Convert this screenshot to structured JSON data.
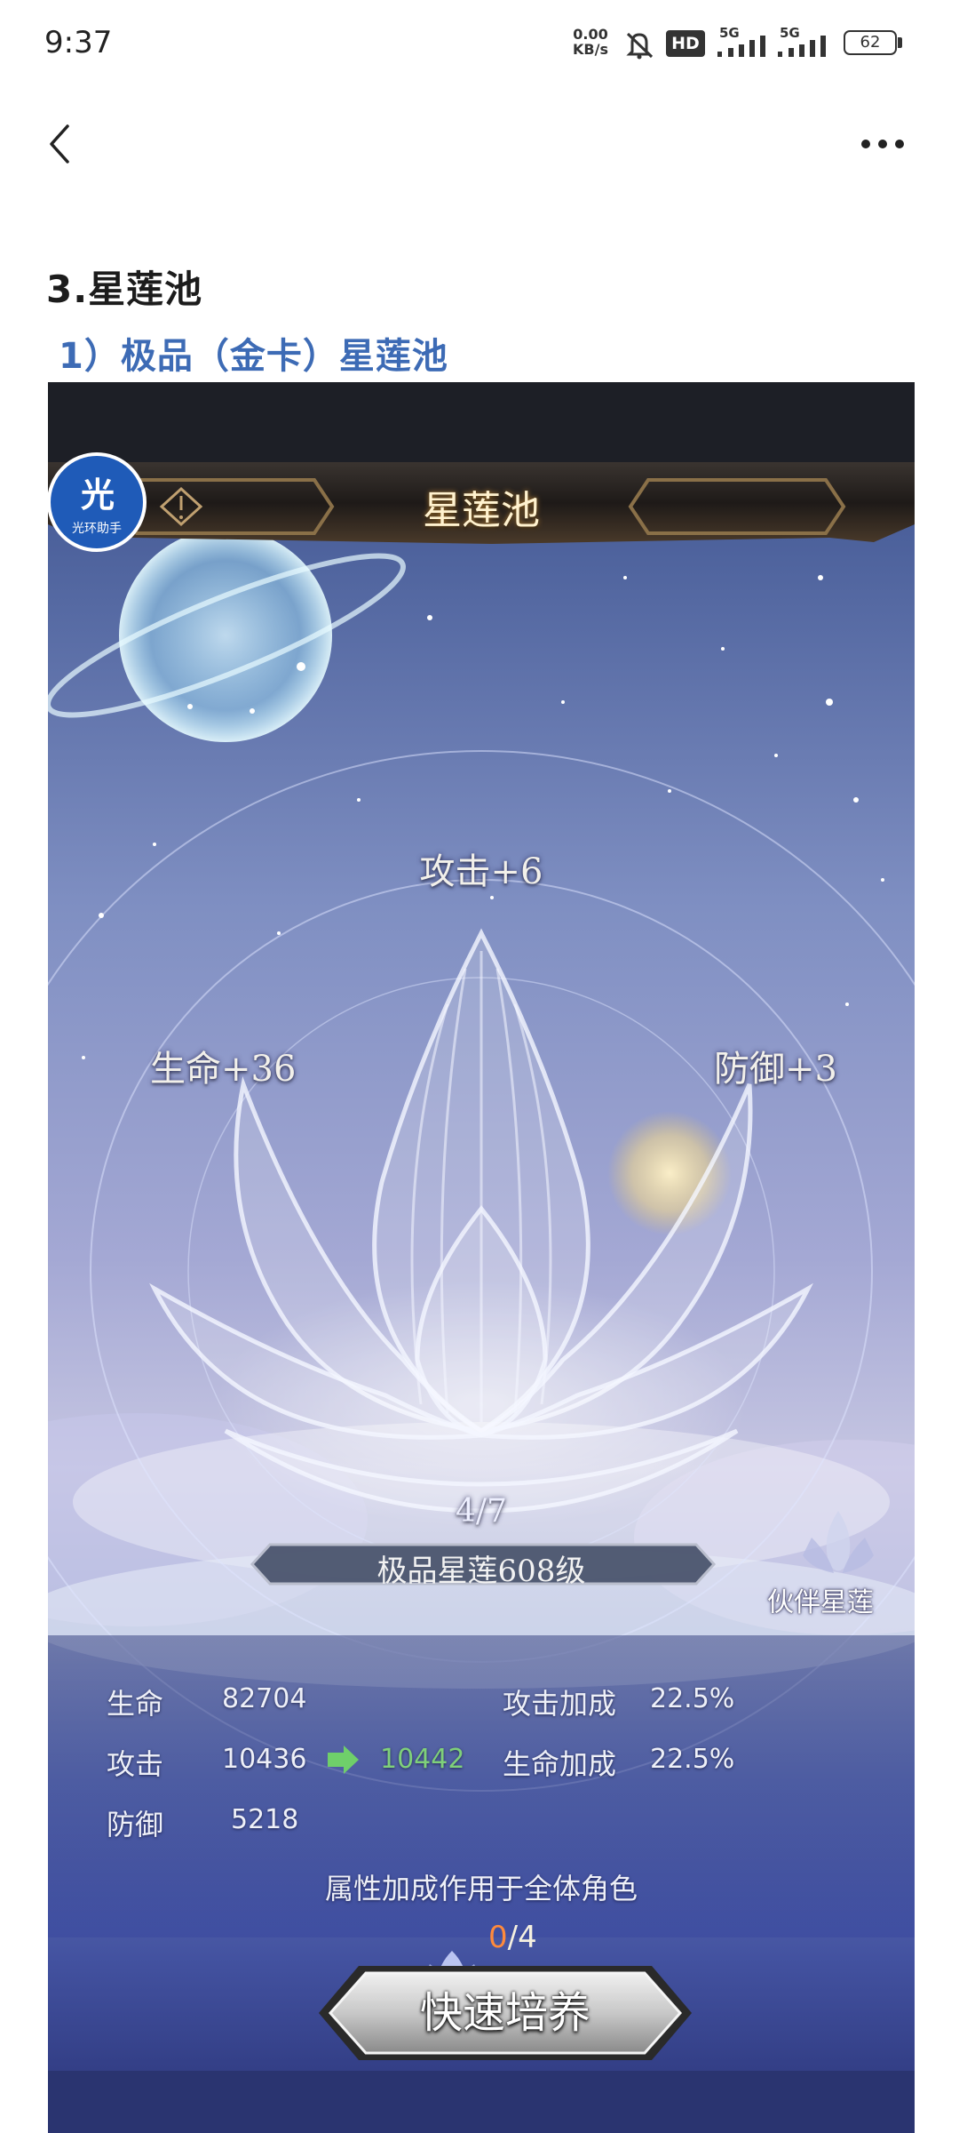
{
  "status_bar": {
    "time": "9:37",
    "net_speed_value": "0.00",
    "net_speed_unit": "KB/s",
    "hd_label": "HD",
    "network_1": "5G",
    "network_2": "5G",
    "battery": "62",
    "icons": [
      "mute-bell-icon",
      "hd-icon",
      "signal-icon",
      "signal-icon",
      "battery-icon"
    ]
  },
  "nav": {
    "back_icon": "chevron-left-icon",
    "more_icon": "more-horizontal-icon"
  },
  "article": {
    "heading_main": "3.星莲池",
    "heading_sub": "1）极品（金卡）星莲池"
  },
  "game": {
    "title": "星莲池",
    "badge_main": "光",
    "badge_sub": "光环助手",
    "bonus_top": "攻击+6",
    "bonus_left": "生命+36",
    "bonus_right": "防御+3",
    "progress": "4/7",
    "level_label": "极品星莲608级",
    "partner_label": "伙伴星莲",
    "stats": {
      "hp_label": "生命",
      "hp_value": "82704",
      "atk_label": "攻击",
      "atk_value": "10436",
      "atk_next": "10442",
      "def_label": "防御",
      "def_value": "5218",
      "atk_bonus_label": "攻击加成",
      "atk_bonus_value": "22.5%",
      "hp_bonus_label": "生命加成",
      "hp_bonus_value": "22.5%"
    },
    "note": "属性加成作用于全体角色",
    "counter_current": "0",
    "counter_sep": "/",
    "counter_max": "4",
    "button_label": "快速培养",
    "colors": {
      "accent_blue": "#3d6bb5",
      "green_value": "#7fd07a",
      "counter_orange": "#ff8a3c"
    }
  }
}
